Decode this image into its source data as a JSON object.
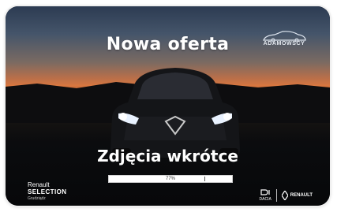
{
  "banner": {
    "title": "Nowa oferta",
    "subtitle": "Zdjęcia wkrótce",
    "progress_label": "77%",
    "progress_value": 0.77
  },
  "dealer": {
    "name": "ADAMOWSCY",
    "icon": "car-outline-logo"
  },
  "brand": {
    "line1": "Renault",
    "line2": "SELECTION",
    "line3": "Grudziądz"
  },
  "partner_logos": {
    "dacia": "DACIA",
    "renault": "RENAULT"
  },
  "colors": {
    "title": "#ffffff",
    "sunset": "#d9773f",
    "sky": "#2c3b52"
  }
}
